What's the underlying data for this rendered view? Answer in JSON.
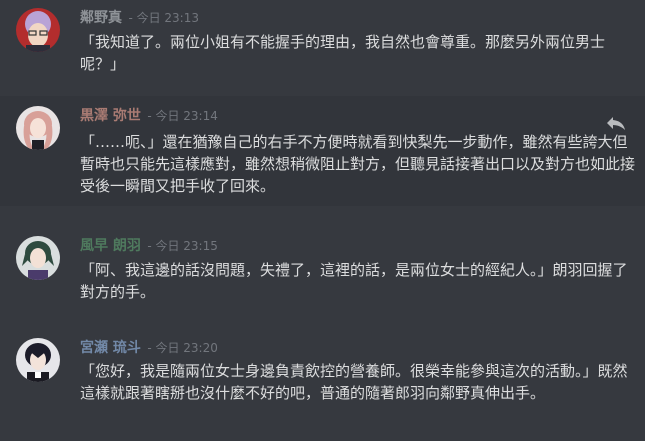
{
  "messages": [
    {
      "author": "鄰野真",
      "timestamp": "- 今日 23:13",
      "author_color": "#8e9297",
      "avatar_icon": "avatar-purple-hair-glasses",
      "text": "「我知道了。兩位小姐有不能握手的理由，我自然也會尊重。那麼另外兩位男士呢？」"
    },
    {
      "author": "黒澤 弥世",
      "timestamp": "- 今日 23:14",
      "author_color": "#a97b73",
      "avatar_icon": "avatar-pink-hair",
      "text": "「……呃、」還在猶豫自己的右手不方便時就看到快梨先一步動作，雖然有些誇大但暫時也只能先這樣應對，雖然想稍微阻止對方，但聽見話接著出口以及對方也如此接受後一瞬間又把手收了回來。",
      "reply_icon": "reply-arrow-icon"
    },
    {
      "author": "風早 朗羽",
      "timestamp": "- 今日 23:15",
      "author_color": "#4f7a5e",
      "avatar_icon": "avatar-green-hair",
      "text": "「阿、我這邊的話沒問題，失禮了，這裡的話，是兩位女士的經紀人。」朗羽回握了對方的手。"
    },
    {
      "author": "宮瀬 琉斗",
      "timestamp": "- 今日 23:20",
      "author_color": "#7289a8",
      "avatar_icon": "avatar-dark-hair",
      "text": "「您好，我是隨兩位女士身邊負責飲控的營養師。很榮幸能參與這次的活動。」既然這樣就跟著瞎掰也沒什麼不好的吧，普通的隨著郎羽向鄰野真伸出手。"
    }
  ]
}
